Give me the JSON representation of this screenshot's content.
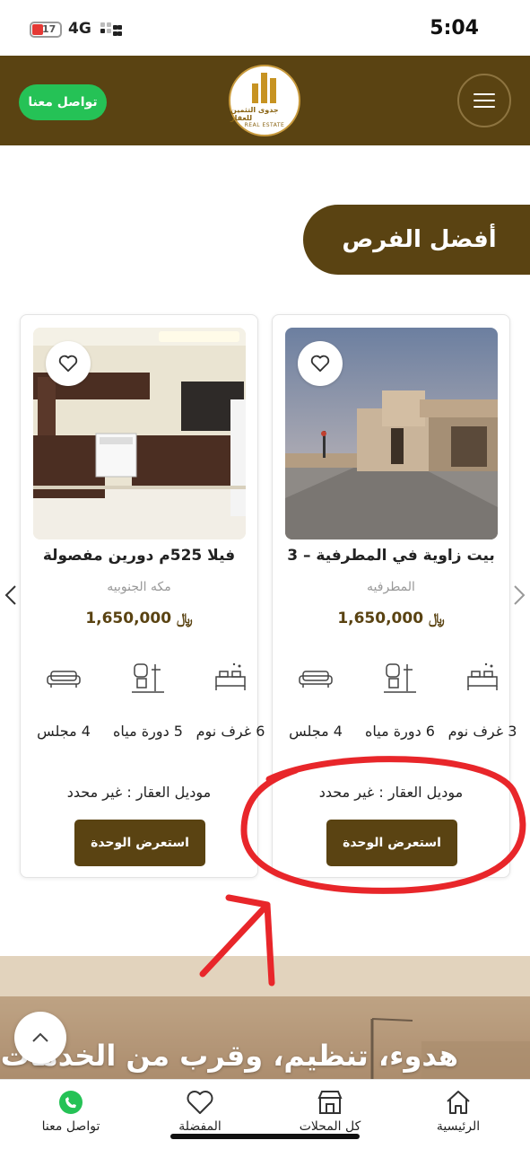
{
  "status_bar": {
    "battery": "17",
    "network": "4G",
    "time": "5:04"
  },
  "header": {
    "contact_label": "تواصل معنا",
    "logo_name": "جدوى التثمين للعقار",
    "logo_sub": "REAL ESTATE"
  },
  "section_title": "أفضل الفرص",
  "cards": [
    {
      "title": "بيت زاوية في المطرفية – 3",
      "location": "المطرفيه",
      "price": "1,650,000",
      "currency": "⃁",
      "features": {
        "rooms": "3 غرف نوم",
        "bathrooms": "6 دورة مياه",
        "majlis": "4 مجلس"
      },
      "model": "موديل العقار : غير محدد",
      "button": "استعرض الوحدة"
    },
    {
      "title": "فيلا 525م دورين مفصولة",
      "location": "مكه الجنوبيه",
      "price": "1,650,000",
      "currency": "⃁",
      "features": {
        "rooms": "6 غرف نوم",
        "bathrooms": "5 دورة مياه",
        "majlis": "4 مجلس"
      },
      "model": "موديل العقار : غير محدد",
      "button": "استعرض الوحدة"
    }
  ],
  "banner_text": "هدوء، تنظيم، وقرب من الخدمات",
  "bottom_nav": [
    {
      "label": "الرئيسية",
      "icon": "home-icon"
    },
    {
      "label": "كل المحلات",
      "icon": "store-icon"
    },
    {
      "label": "المفضلة",
      "icon": "heart-icon"
    },
    {
      "label": "تواصل معنا",
      "icon": "whatsapp-icon"
    }
  ],
  "colors": {
    "brand_brown": "#5a4312",
    "whatsapp_green": "#25c256",
    "annotation_red": "#e8262a"
  }
}
